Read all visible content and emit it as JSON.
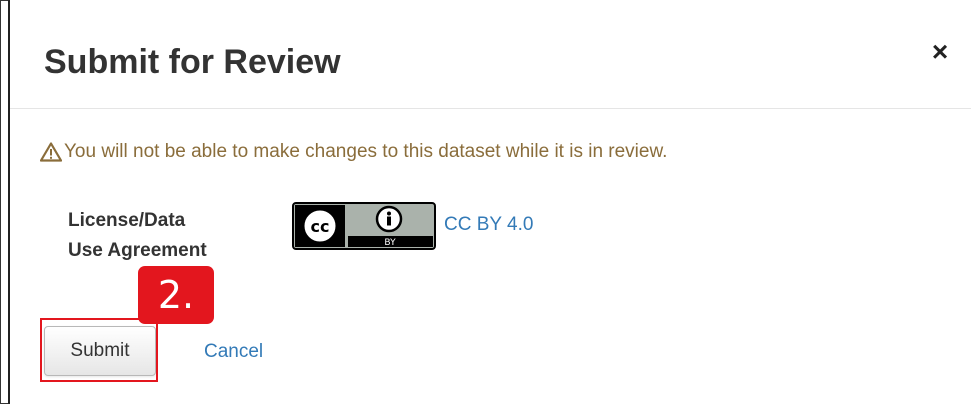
{
  "modal": {
    "title": "Submit for Review",
    "close_glyph": "×",
    "warning_text": "You will not be able to make changes to this dataset while it is in review.",
    "warning_icon": "warning-triangle-icon",
    "license": {
      "label_line1": "License/Data",
      "label_line2": "Use Agreement",
      "badge_icon": "cc-by-badge-icon",
      "badge_text": "BY",
      "link_text": "CC BY 4.0"
    },
    "actions": {
      "submit_label": "Submit",
      "cancel_label": "Cancel"
    }
  },
  "annotation": {
    "step_label": "2.",
    "color": "#e3161e"
  },
  "colors": {
    "warning_text": "#8a6d3b",
    "link": "#337ab7",
    "title": "#333333"
  }
}
